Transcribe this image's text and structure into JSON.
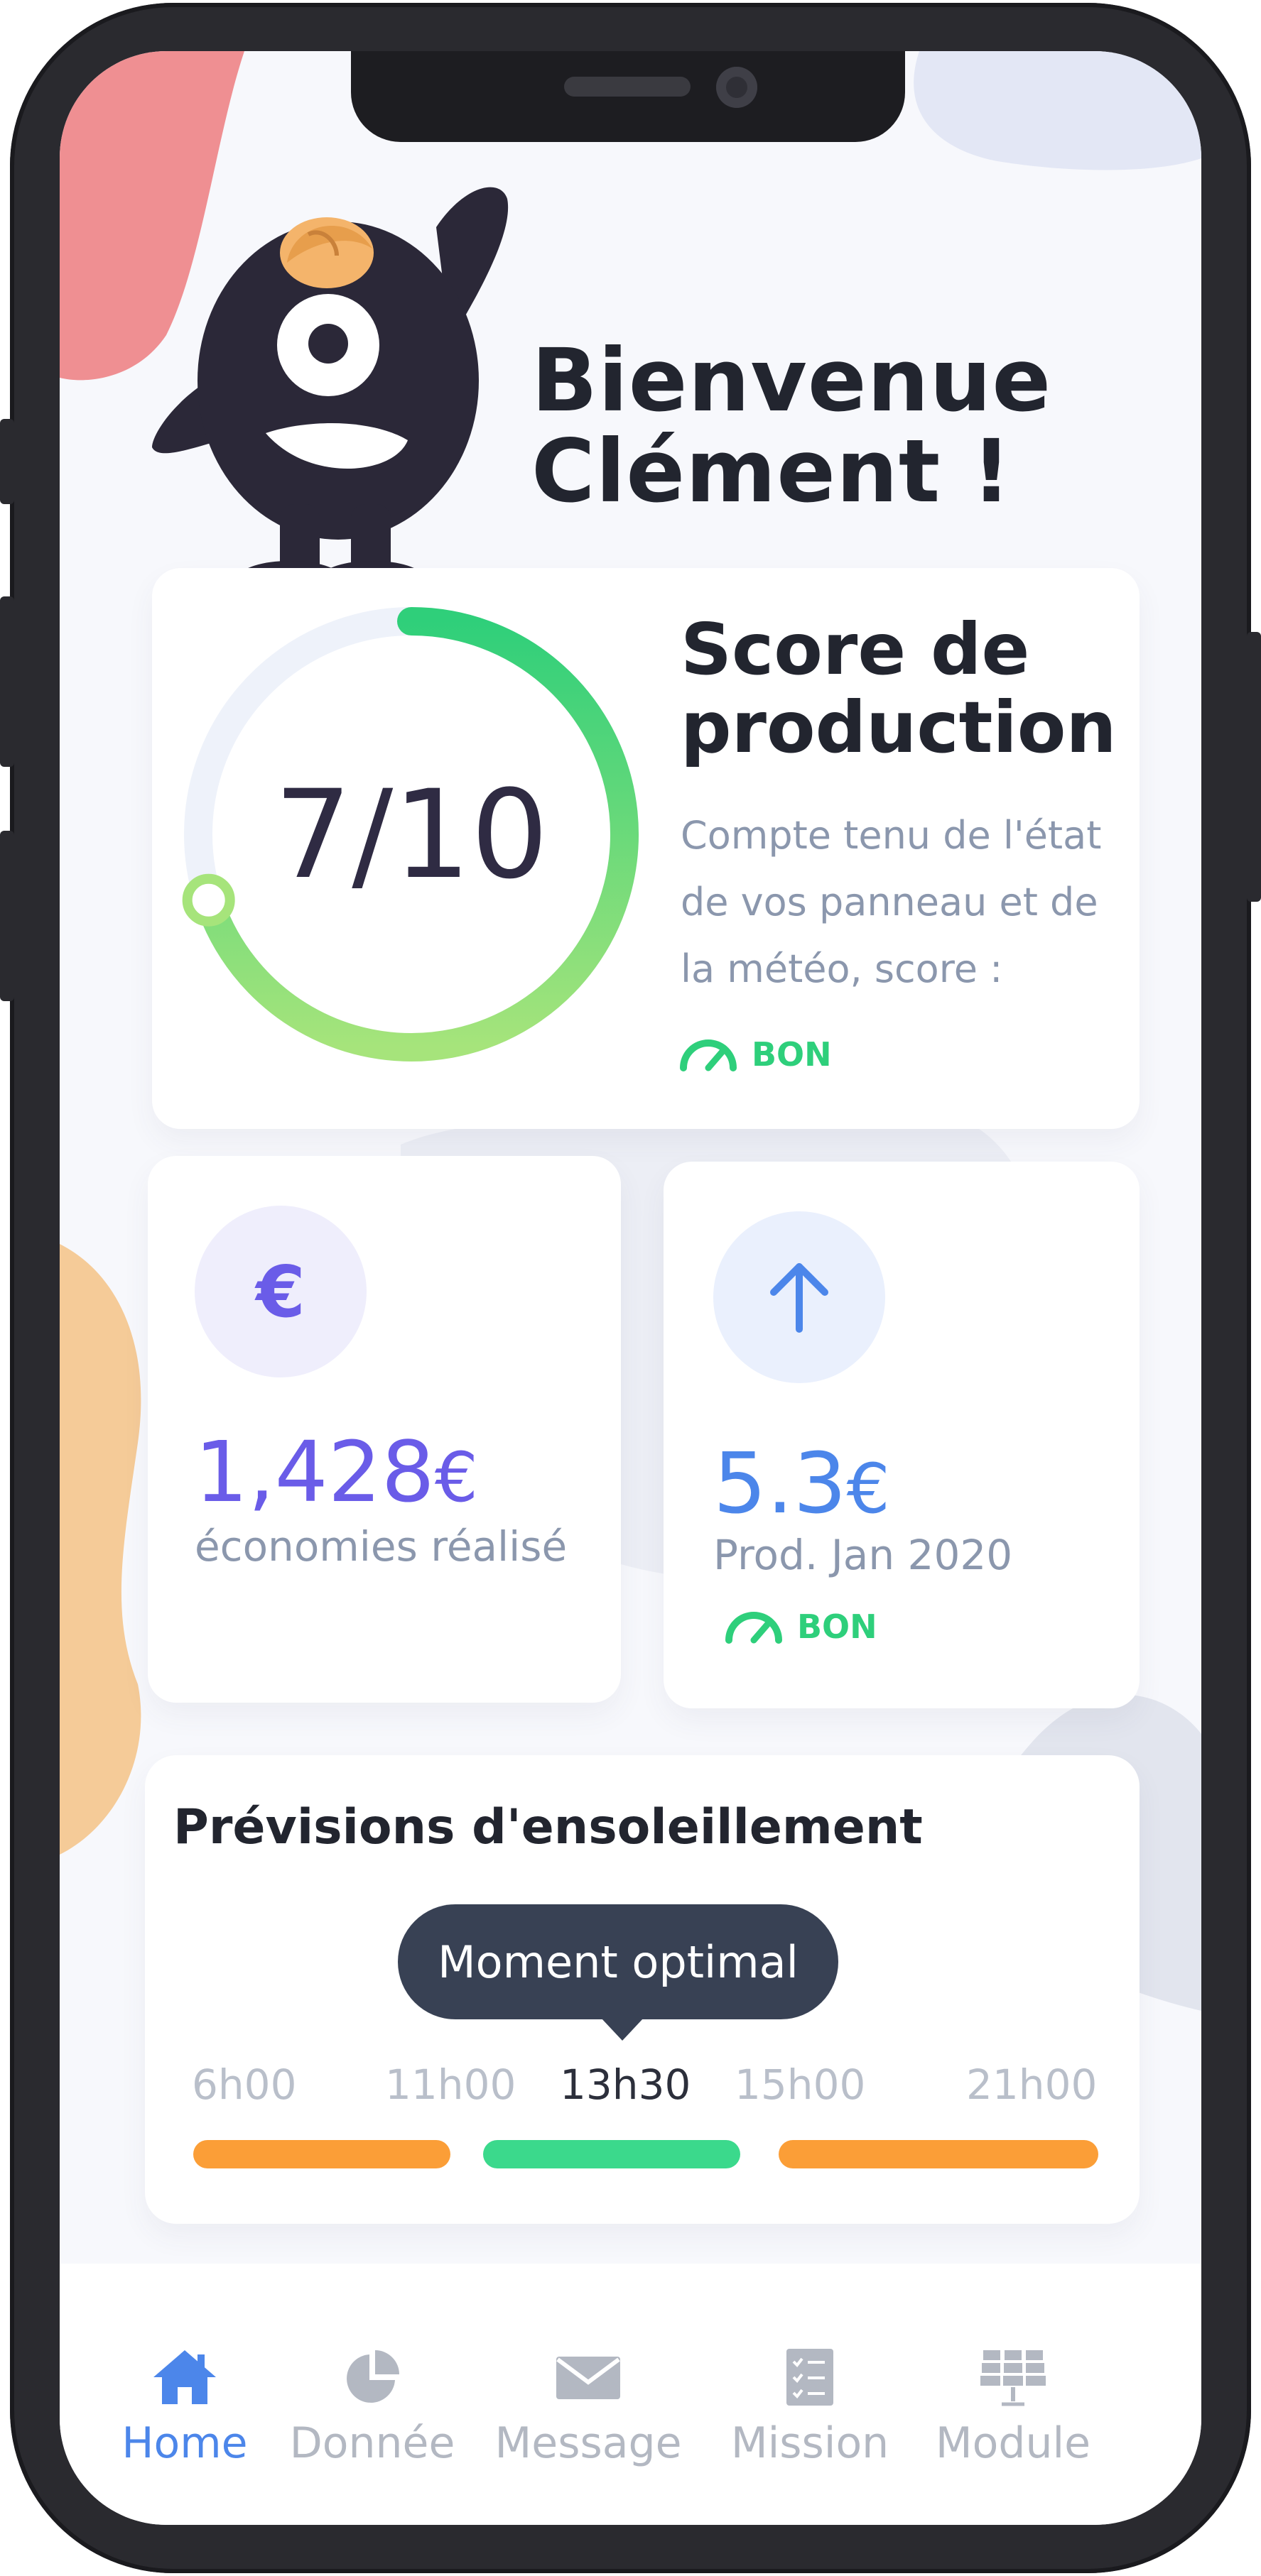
{
  "header": {
    "greeting_line1": "Bienvenue",
    "greeting_line2": "Clément !"
  },
  "score": {
    "value": "7/10",
    "progress": 0.7,
    "title_line1": "Score de",
    "title_line2": "production",
    "desc_line1": "Compte tenu de l'état",
    "desc_line2": "de vos panneau et de",
    "desc_line3": "la météo, score :",
    "status": "BON"
  },
  "savings": {
    "icon": "euro-icon",
    "amount": "1,428",
    "currency": "€",
    "label": "économies réalisé"
  },
  "production": {
    "icon": "arrow-up-icon",
    "amount": "5.3",
    "currency": "€",
    "label": "Prod. Jan 2020",
    "status": "BON"
  },
  "forecast": {
    "title": "Prévisions d'ensoleillement",
    "tooltip": "Moment optimal",
    "times": [
      "6h00",
      "11h00",
      "13h30",
      "15h00",
      "21h00"
    ],
    "active_time": "13h30"
  },
  "tabs": [
    {
      "label": "Home",
      "icon": "home-icon",
      "active": true
    },
    {
      "label": "Donnée",
      "icon": "pie-chart-icon",
      "active": false
    },
    {
      "label": "Message",
      "icon": "envelope-icon",
      "active": false
    },
    {
      "label": "Mission",
      "icon": "checklist-icon",
      "active": false
    },
    {
      "label": "Module",
      "icon": "solar-panel-icon",
      "active": false
    }
  ],
  "colors": {
    "accent_purple": "#6a5ce8",
    "accent_blue": "#4c86ea",
    "good_green": "#2ecf7b",
    "bar_orange": "#fb9e37",
    "bar_green": "#3bd98c"
  }
}
